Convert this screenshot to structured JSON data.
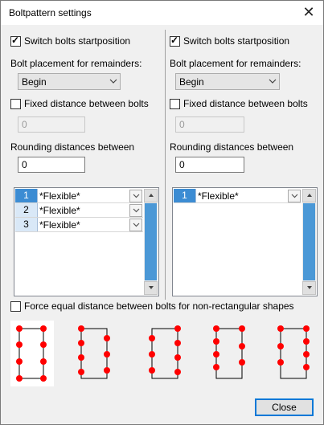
{
  "window": {
    "title": "Boltpattern settings",
    "close_glyph": "✕"
  },
  "left": {
    "switch_label": "Switch bolts startposition",
    "switch_checked": true,
    "placement_label": "Bolt placement for remainders:",
    "placement_value": "Begin",
    "fixed_label": "Fixed distance between bolts",
    "fixed_checked": false,
    "fixed_value": "0",
    "rounding_label": "Rounding distances between",
    "rounding_value": "0",
    "rows": [
      {
        "num": "1",
        "value": "*Flexible*"
      },
      {
        "num": "2",
        "value": "*Flexible*"
      },
      {
        "num": "3",
        "value": "*Flexible*"
      }
    ]
  },
  "right": {
    "switch_label": "Switch bolts startposition",
    "switch_checked": true,
    "placement_label": "Bolt placement for remainders:",
    "placement_value": "Begin",
    "fixed_label": "Fixed distance between bolts",
    "fixed_checked": false,
    "fixed_value": "0",
    "rounding_label": "Rounding distances between",
    "rounding_value": "0",
    "rows": [
      {
        "num": "1",
        "value": "*Flexible*"
      }
    ]
  },
  "force_label": "Force equal distance between bolts for non-rectangular shapes",
  "force_checked": false,
  "icons": {
    "combo_arrow": "chevron-down-icon",
    "scroll_up": "arrow-up-icon",
    "scroll_down": "arrow-down-icon"
  },
  "colors": {
    "bolt": "#ff0000",
    "frame": "#000000",
    "accent": "#0078d7",
    "selection": "#4b98d6"
  },
  "close_button": "Close"
}
